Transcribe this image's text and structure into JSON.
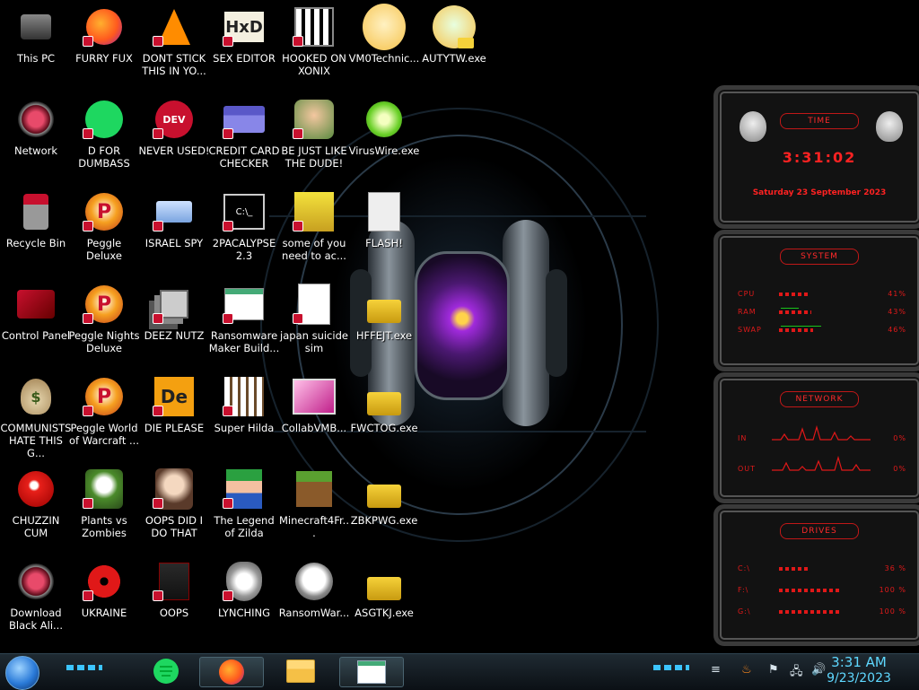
{
  "desktop": {
    "icons": [
      {
        "label": "This PC",
        "icon": "computer-icon",
        "shortcut": false
      },
      {
        "label": "FURRY FUX",
        "icon": "firefox-icon",
        "shortcut": true
      },
      {
        "label": "DONT STICK THIS IN YO...",
        "icon": "vlc-cone-icon",
        "shortcut": true
      },
      {
        "label": "SEX EDITOR",
        "icon": "hxd-editor-icon",
        "shortcut": true
      },
      {
        "label": "HOOKED ON XONIX",
        "icon": "xonix-icon",
        "shortcut": true
      },
      {
        "label": "VM0Technic...",
        "icon": "anime-face-icon",
        "shortcut": false
      },
      {
        "label": "AUTYTW.exe",
        "icon": "anime-face-padlock-icon",
        "shortcut": false
      },
      {
        "label": "Network",
        "icon": "alien-network-icon",
        "shortcut": false
      },
      {
        "label": "D FOR DUMBASS",
        "icon": "green-chat-icon",
        "shortcut": true
      },
      {
        "label": "NEVER USED!",
        "icon": "dev-cpp-icon",
        "shortcut": true
      },
      {
        "label": "CREDIT CARD CHECKER",
        "icon": "credit-card-icon",
        "shortcut": true
      },
      {
        "label": "BE JUST LIKE THE DUDE!",
        "icon": "elf-santa-icon",
        "shortcut": true
      },
      {
        "label": "VirusWire.exe",
        "icon": "lime-icon",
        "shortcut": false
      },
      {
        "label": "Recycle Bin",
        "icon": "recycle-bin-icon",
        "shortcut": false
      },
      {
        "label": "Peggle Deluxe",
        "icon": "peggle-icon",
        "shortcut": true
      },
      {
        "label": "ISRAEL SPY",
        "icon": "network-spy-icon",
        "shortcut": true
      },
      {
        "label": "2PACALYPSE 2.3",
        "icon": "terminal-icon",
        "shortcut": true
      },
      {
        "label": "some of you need to ac...",
        "icon": "cartoon-dog-icon",
        "shortcut": true
      },
      {
        "label": "FLASH!",
        "icon": "flash-file-icon",
        "shortcut": false
      },
      {
        "label": "Control Panel",
        "icon": "control-panel-icon",
        "shortcut": false
      },
      {
        "label": "Peggle Nights Deluxe",
        "icon": "peggle-icon",
        "shortcut": true
      },
      {
        "label": "DEEZ NUTZ",
        "icon": "stacked-windows-icon",
        "shortcut": true
      },
      {
        "label": "Ransomware Maker Build...",
        "icon": "window-app-icon",
        "shortcut": true
      },
      {
        "label": "japan suicide sim",
        "icon": "document-icon",
        "shortcut": true
      },
      {
        "label": "HFFEJT.exe",
        "icon": "padlock-icon",
        "shortcut": false
      },
      {
        "label": "COMMUNISTS HATE THIS G...",
        "icon": "money-bag-icon",
        "shortcut": false
      },
      {
        "label": "Peggle World of Warcraft ...",
        "icon": "peggle-icon",
        "shortcut": true
      },
      {
        "label": "DIE PLEASE",
        "icon": "de-editor-icon",
        "shortcut": true
      },
      {
        "label": "Super Hilda",
        "icon": "pixel-dog-icon",
        "shortcut": true
      },
      {
        "label": "CollabVMB...",
        "icon": "pink-monitor-icon",
        "shortcut": false
      },
      {
        "label": "FWCTOG.exe",
        "icon": "padlock-icon",
        "shortcut": false
      },
      {
        "label": "CHUZZIN CUM",
        "icon": "chuzzle-icon",
        "shortcut": false
      },
      {
        "label": "Plants vs Zombies",
        "icon": "plant-icon",
        "shortcut": true
      },
      {
        "label": "OOPS DID I DO THAT",
        "icon": "portrait-icon",
        "shortcut": true
      },
      {
        "label": "The Legend of Zilda",
        "icon": "pixel-hero-icon",
        "shortcut": true
      },
      {
        "label": "Minecraft4Fr...",
        "icon": "grass-block-icon",
        "shortcut": false
      },
      {
        "label": "ZBKPWG.exe",
        "icon": "padlock-icon",
        "shortcut": false
      },
      {
        "label": "Download Black Ali...",
        "icon": "alien-network-icon",
        "shortcut": false
      },
      {
        "label": "UKRAINE",
        "icon": "radiation-icon",
        "shortcut": true
      },
      {
        "label": "OOPS",
        "icon": "alienware-book-icon",
        "shortcut": true
      },
      {
        "label": "LYNCHING",
        "icon": "shield-emblem-icon",
        "shortcut": true
      },
      {
        "label": "RansomWar...",
        "icon": "skull-icon",
        "shortcut": false
      },
      {
        "label": "ASGTKJ.exe",
        "icon": "padlock-icon",
        "shortcut": false
      }
    ]
  },
  "gadgets": {
    "time": {
      "heading": "TIME",
      "clock": "3:31:02",
      "date": "Saturday 23 September 2023"
    },
    "system": {
      "heading": "SYSTEM",
      "rows": [
        {
          "name": "CPU",
          "value": "41%",
          "level": 0.41
        },
        {
          "name": "RAM",
          "value": "43%",
          "level": 0.43
        },
        {
          "name": "SWAP",
          "value": "46%",
          "level": 0.46
        }
      ]
    },
    "network": {
      "heading": "NETWORK",
      "rows": [
        {
          "name": "IN",
          "value": "0%"
        },
        {
          "name": "OUT",
          "value": "0%"
        }
      ]
    },
    "drives": {
      "heading": "DRIVES",
      "rows": [
        {
          "name": "C:\\",
          "value": "36 %",
          "level": 0.36
        },
        {
          "name": "F:\\",
          "value": "100 %",
          "level": 1.0
        },
        {
          "name": "G:\\",
          "value": "100 %",
          "level": 1.0
        }
      ]
    }
  },
  "taskbar": {
    "start_icon": "start-orb-icon",
    "pinned": [
      {
        "name": "green-chat-icon"
      },
      {
        "name": "firefox-icon",
        "active": true
      },
      {
        "name": "file-explorer-icon"
      },
      {
        "name": "window-app-icon",
        "active": true
      }
    ],
    "tray": {
      "time": "3:31 AM",
      "date": "9/23/2023"
    }
  },
  "colors": {
    "gadget_red": "#e01a1a",
    "clock_cyan": "#5fd8ff",
    "shortcut_badge": "#c8102e"
  }
}
